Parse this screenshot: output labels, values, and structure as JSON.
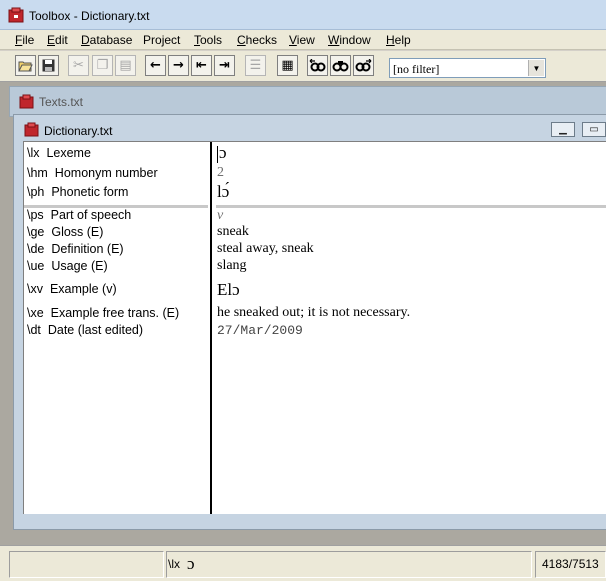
{
  "app": {
    "title": "Toolbox - Dictionary.txt"
  },
  "menu": [
    "File",
    "Edit",
    "Database",
    "Project",
    "Tools",
    "Checks",
    "View",
    "Window",
    "Help"
  ],
  "menu_mnemonics": [
    "F",
    "E",
    "D",
    "j",
    "T",
    "C",
    "V",
    "W",
    "H"
  ],
  "toolbar": {
    "icons": [
      "open-folder-icon",
      "save-icon",
      "cut-icon",
      "copy-icon",
      "paste-icon",
      "arrow-left-icon",
      "arrow-right-icon",
      "jump-first-icon",
      "jump-last-icon",
      "browse-icon",
      "table-icon",
      "find-prev-icon",
      "find-icon",
      "find-next-icon"
    ],
    "arrow_left": "←",
    "arrow_right": "→",
    "jump_first": "⇤",
    "jump_last": "⇥",
    "filter_value": "[no filter]"
  },
  "windows": {
    "texts_title": "Texts.txt",
    "dict_title": "Dictionary.txt"
  },
  "record": {
    "fields": [
      {
        "marker": "\\lx",
        "label": "Lexeme",
        "value": "ɔ"
      },
      {
        "marker": "\\hm",
        "label": "Homonym number",
        "value": "2"
      },
      {
        "marker": "\\ph",
        "label": "Phonetic form",
        "value": "lɔ́"
      },
      {
        "marker": "\\ps",
        "label": "Part of speech",
        "value": "v"
      },
      {
        "marker": "\\ge",
        "label": "Gloss (E)",
        "value": "sneak"
      },
      {
        "marker": "\\de",
        "label": "Definition (E)",
        "value": "steal away, sneak"
      },
      {
        "marker": "\\ue",
        "label": "Usage (E)",
        "value": "slang"
      },
      {
        "marker": "\\xv",
        "label": "Example (v)",
        "value": "Elɔ"
      },
      {
        "marker": "\\xe",
        "label": "Example free trans. (E)",
        "value": "he sneaked out; it is not necessary."
      },
      {
        "marker": "\\dt",
        "label": "Date (last edited)",
        "value": "27/Mar/2009"
      }
    ]
  },
  "status": {
    "marker_field": "\\lx",
    "current_value": "ɔ",
    "position": "4183/7513"
  },
  "colors": {
    "titlebar": "#c9dbef",
    "menubar": "#ece9d8",
    "mdi_background": "#aba8a0",
    "icon_red": "#c0262c"
  }
}
